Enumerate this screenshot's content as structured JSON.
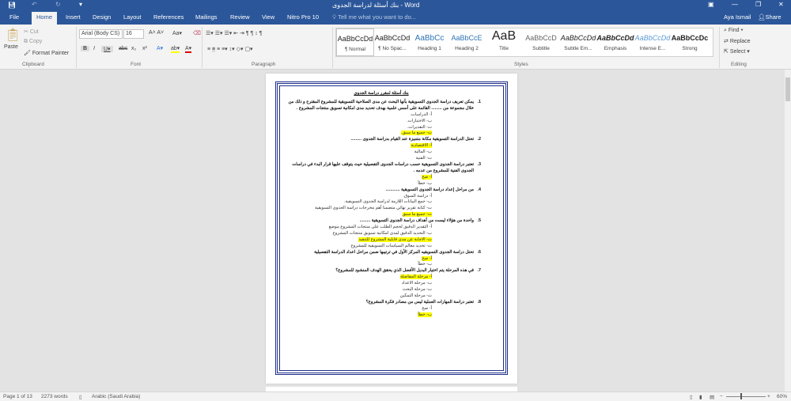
{
  "title_bar": {
    "title": "بنك أسئلة لدراسة الجدوى - Word",
    "save_icon": "save-icon",
    "undo_icon": "undo-icon",
    "redo_icon": "redo-icon"
  },
  "tabs": [
    "File",
    "Home",
    "Insert",
    "Design",
    "Layout",
    "References",
    "Mailings",
    "Review",
    "View",
    "Nitro Pro 10"
  ],
  "tell_me": "Tell me what you want to do...",
  "user": "Aya Ismail",
  "share": "Share",
  "clipboard": {
    "paste": "Paste",
    "cut": "Cut",
    "copy": "Copy",
    "format_painter": "Format Painter",
    "group": "Clipboard"
  },
  "font": {
    "name": "Arial (Body CS)",
    "size": "16",
    "group": "Font"
  },
  "paragraph": {
    "group": "Paragraph"
  },
  "styles": {
    "group": "Styles",
    "items": [
      {
        "preview": "AaBbCcDd",
        "name": "¶ Normal"
      },
      {
        "preview": "AaBbCcDd",
        "name": "¶ No Spac..."
      },
      {
        "preview": "AaBbCc",
        "name": "Heading 1"
      },
      {
        "preview": "AaBbCcE",
        "name": "Heading 2"
      },
      {
        "preview": "AaB",
        "name": "Title"
      },
      {
        "preview": "AaBbCcD",
        "name": "Subtitle"
      },
      {
        "preview": "AaBbCcDd",
        "name": "Subtle Em..."
      },
      {
        "preview": "AaBbCcDd",
        "name": "Emphasis"
      },
      {
        "preview": "AaBbCcDd",
        "name": "Intense E..."
      },
      {
        "preview": "AaBbCcDc",
        "name": "Strong"
      }
    ]
  },
  "editing": {
    "find": "Find",
    "replace": "Replace",
    "select": "Select",
    "group": "Editing"
  },
  "document": {
    "title": "بنك أسئلة لمقرر دراسة الجدوى",
    "questions": [
      {
        "num": "1.",
        "text": "يمكن تعريف دراسة الجدوى التسويقية بأنها البحث عن مدى الصلاحية التسويقية للمشروع المقترح و ذلك من خلال مجموعة من ......... القائمة على أسس علمية بهدف تحديد مدى امكانية تسويق منتجات المشروع .",
        "options": [
          {
            "t": "أ- الدراسات.",
            "h": false
          },
          {
            "t": "ب- الاختبارات.",
            "h": false
          },
          {
            "t": "ت- التقديرات.",
            "h": false
          },
          {
            "t": "ث- جميع ما سبق.",
            "h": true
          }
        ]
      },
      {
        "num": "2.",
        "text": "تحتل الدراسة التسويقية مكانة متميزة عند القيام بدراسة الجدوى .........",
        "options": [
          {
            "t": "أ- الاقتصادية",
            "h": true
          },
          {
            "t": "ب- المالية",
            "h": false
          },
          {
            "t": "ت- الفنية",
            "h": false
          }
        ]
      },
      {
        "num": "3.",
        "text": "تعتبر دراسة الجدوى التسويقية حسب دراسات الجدوى التفصيلية حيث يتوقف عليها قرار البدء في دراسات الجدوى الفنية للمشروع من عدمه .",
        "options": [
          {
            "t": "أ- صح",
            "h": true
          },
          {
            "t": "ب- خطأ",
            "h": false
          }
        ]
      },
      {
        "num": "4.",
        "text": "من مراحل إعداد دراسة الجدوى التسويقية ............",
        "options": [
          {
            "t": "أ- دراسة السوق.",
            "h": false
          },
          {
            "t": "ب- جمع البيانات اللازمة لدراسة الجدوى التسويقية.",
            "h": false
          },
          {
            "t": "ت- كتابة تقرير نهائي متضمنا أهم مخرجات دراسة الجدوى التسويقية",
            "h": false
          },
          {
            "t": "ث- جميع ما سبق",
            "h": true
          }
        ]
      },
      {
        "num": "5.",
        "text": "واحدة من هؤلاء ليست من أهداف دراسة الجدوى التسويقية .........",
        "options": [
          {
            "t": "أ- التقدير الدقيق لحجم الطلب على منتجات المشروع موضع",
            "h": false
          },
          {
            "t": "ب- التحديد الدقيق لمدى امكانية تسويق منتجات المشروع",
            "h": false
          },
          {
            "t": "ث- الاجابة عن مدى قابلية المشروع للتنفيذ",
            "h": true
          },
          {
            "t": "ث- تحديد معالم السياسات التسويقية للمشروع",
            "h": false
          }
        ]
      },
      {
        "num": "6.",
        "text": "تحتل دراسة الجدوى التسويقيه المركز الأول في ترتيبها ضمن مراحل اعداد الدراسة التفصيلية",
        "options": [
          {
            "t": "أ- صح",
            "h": true
          },
          {
            "t": "ب- خطأ",
            "h": false
          }
        ]
      },
      {
        "num": "7.",
        "text": "في هذه المرحلة يتم اختيار البديل الأفضل الذي يحقق الهدف المنشود للمشروع؟",
        "options": [
          {
            "t": "أ- مرحلة المفاضلة",
            "h": true
          },
          {
            "t": "ب- مرحلة الاعداد",
            "h": false
          },
          {
            "t": "ت- مرحلة البحث",
            "h": false
          },
          {
            "t": "ث- مرحلة التمكين",
            "h": false
          }
        ]
      },
      {
        "num": "8.",
        "text": "تعتبر دراسة المهارات العملية ليس من مصادر فكرة المشروع؟",
        "options": [
          {
            "t": "أ- صح",
            "h": false
          },
          {
            "t": "ب- خطأ",
            "h": true
          }
        ]
      }
    ]
  },
  "status": {
    "page": "Page 1 of 13",
    "words": "2273 words",
    "language": "Arabic (Saudi Arabia)",
    "zoom": "60%"
  }
}
